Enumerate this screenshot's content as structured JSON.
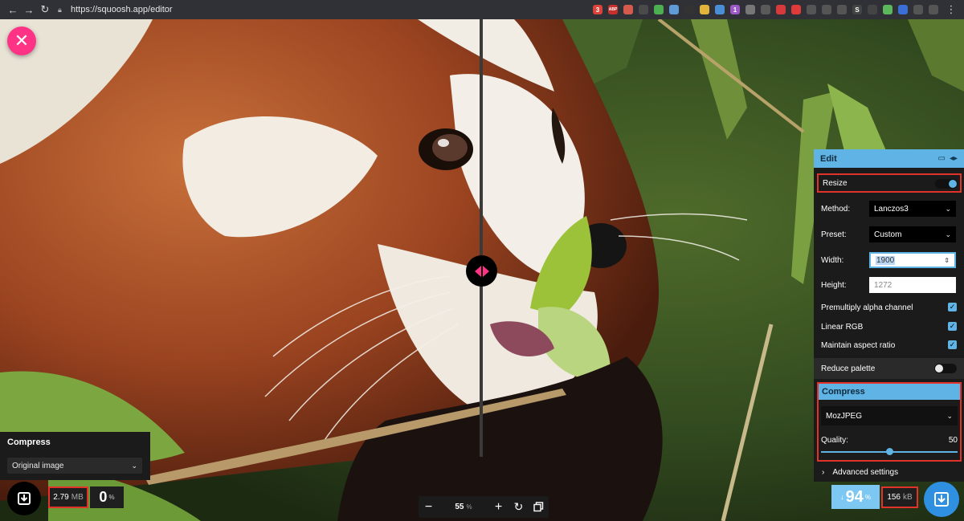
{
  "browser": {
    "url": "https://squoosh.app/editor",
    "extensions": [
      {
        "icon": "mail-ext-icon",
        "color": "#d9443a",
        "label": "3"
      },
      {
        "icon": "abp-ext-icon",
        "color": "#c8312b",
        "label": "ABP"
      },
      {
        "icon": "mail-ext-icon-2",
        "color": "#d65a4c",
        "label": ""
      },
      {
        "icon": "pocket-ext-icon",
        "color": "#4a4a4a",
        "label": ""
      },
      {
        "icon": "leaf-ext-icon",
        "color": "#4caf50",
        "label": ""
      },
      {
        "icon": "cloud-ext-icon",
        "color": "#5f9bd6",
        "label": ""
      },
      {
        "icon": "drop-ext-icon",
        "color": "#333",
        "label": ""
      },
      {
        "icon": "face-ext-icon",
        "color": "#e3b43a",
        "label": ""
      },
      {
        "icon": "chart-ext-icon",
        "color": "#4a8fd6",
        "label": ""
      },
      {
        "icon": "tag-ext-icon",
        "color": "#9c58c8",
        "label": "1"
      },
      {
        "icon": "shield-ext-icon",
        "color": "#777",
        "label": ""
      },
      {
        "icon": "pin-ext-icon",
        "color": "#5a5a5a",
        "label": ""
      },
      {
        "icon": "s-ext-icon",
        "color": "#d63a3a",
        "label": ""
      },
      {
        "icon": "square-ext-icon",
        "color": "#e03a3a",
        "label": ""
      },
      {
        "icon": "link-ext-icon",
        "color": "#555",
        "label": ""
      },
      {
        "icon": "font-ext-icon",
        "color": "#555",
        "label": ""
      },
      {
        "icon": "ghost-ext-icon",
        "color": "#555",
        "label": ""
      },
      {
        "icon": "s-ext-icon-2",
        "color": "#444",
        "label": "S"
      },
      {
        "icon": "line-ext-icon",
        "color": "#444",
        "label": ""
      },
      {
        "icon": "green-ext-icon",
        "color": "#5cb85c",
        "label": ""
      },
      {
        "icon": "blue-ext-icon",
        "color": "#3b6fd6",
        "label": ""
      },
      {
        "icon": "gear-ext-icon",
        "color": "#555",
        "label": ""
      },
      {
        "icon": "puzzle-ext-icon",
        "color": "#555",
        "label": ""
      }
    ]
  },
  "editor": {
    "left": {
      "title": "Compress",
      "codec": "Original image",
      "size_value": "2.79",
      "size_unit": "MB",
      "pct_value": "0",
      "pct_unit": "%"
    },
    "zoom": {
      "minus": "−",
      "value": "55",
      "unit": "%",
      "plus": "+"
    },
    "right": {
      "header": "Edit",
      "resize_label": "Resize",
      "resize_on": true,
      "method_label": "Method:",
      "method_value": "Lanczos3",
      "preset_label": "Preset:",
      "preset_value": "Custom",
      "width_label": "Width:",
      "width_value": "1900",
      "height_label": "Height:",
      "height_value": "1272",
      "premultiply_label": "Premultiply alpha channel",
      "linear_rgb_label": "Linear RGB",
      "aspect_label": "Maintain aspect ratio",
      "reduce_palette_label": "Reduce palette",
      "reduce_palette_on": false,
      "compress_title": "Compress",
      "codec": "MozJPEG",
      "quality_label": "Quality:",
      "quality_value": "50",
      "quality_level": 0.5,
      "advanced_label": "Advanced settings",
      "pct_arrow": "↓",
      "pct_value": "94",
      "pct_unit": "%",
      "size_value": "156",
      "size_unit": "kB"
    }
  },
  "colors": {
    "accent_pink": "#ff3385",
    "accent_blue": "#5fb3e5",
    "highlight_red": "#e1332a"
  }
}
